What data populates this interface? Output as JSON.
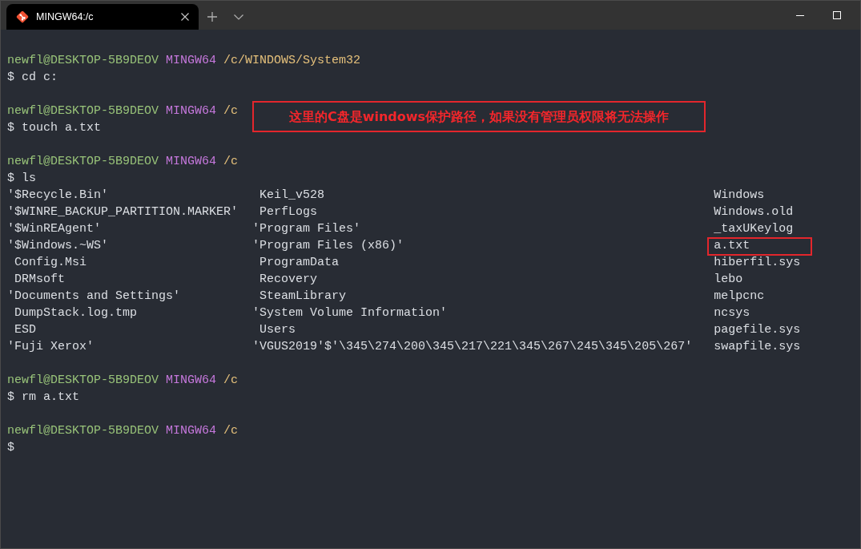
{
  "window": {
    "tab": {
      "title": "MINGW64:/c",
      "selected": true
    }
  },
  "terminal": {
    "blocks": [
      {
        "prompt": {
          "user": "newfl@DESKTOP-5B9DEOV",
          "system": "MINGW64",
          "path": "/c/WINDOWS/System32"
        },
        "command": "$ cd c:"
      },
      {
        "prompt": {
          "user": "newfl@DESKTOP-5B9DEOV",
          "system": "MINGW64",
          "path": "/c"
        },
        "command": "$ touch a.txt"
      },
      {
        "prompt": {
          "user": "newfl@DESKTOP-5B9DEOV",
          "system": "MINGW64",
          "path": "/c"
        },
        "command": "$ ls",
        "listing": {
          "columns": [
            [
              {
                "name": "'$Recycle.Bin'",
                "kind": "quoted",
                "highlighted": false
              },
              {
                "name": "'$WINRE_BACKUP_PARTITION.MARKER'",
                "kind": "quoted",
                "highlighted": false
              },
              {
                "name": "'$WinREAgent'",
                "kind": "quoted",
                "highlighted": false
              },
              {
                "name": "'$Windows.~WS'",
                "kind": "quoted",
                "highlighted": false
              },
              {
                "name": "Config.Msi",
                "kind": "plain",
                "highlighted": false
              },
              {
                "name": "DRMsoft",
                "kind": "plain",
                "highlighted": false
              },
              {
                "name": "'Documents and Settings'",
                "kind": "quoted",
                "highlighted": false
              },
              {
                "name": "DumpStack.log.tmp",
                "kind": "plain",
                "highlighted": false
              },
              {
                "name": "ESD",
                "kind": "plain",
                "highlighted": false
              },
              {
                "name": "'Fuji Xerox'",
                "kind": "quoted",
                "highlighted": false
              }
            ],
            [
              {
                "name": "Keil_v528",
                "kind": "plain",
                "highlighted": false
              },
              {
                "name": "PerfLogs",
                "kind": "plain",
                "highlighted": false
              },
              {
                "name": "'Program Files'",
                "kind": "quoted",
                "highlighted": false
              },
              {
                "name": "'Program Files (x86)'",
                "kind": "quoted",
                "highlighted": false
              },
              {
                "name": "ProgramData",
                "kind": "plain",
                "highlighted": false
              },
              {
                "name": "Recovery",
                "kind": "plain",
                "highlighted": false
              },
              {
                "name": "SteamLibrary",
                "kind": "plain",
                "highlighted": false
              },
              {
                "name": "'System Volume Information'",
                "kind": "quoted",
                "highlighted": false
              },
              {
                "name": "Users",
                "kind": "plain",
                "highlighted": false
              },
              {
                "name": "'VGUS2019'$'\\345\\274\\200\\345\\217\\221\\345\\267\\245\\345\\205\\267'",
                "kind": "quoted",
                "highlighted": false
              }
            ],
            [
              {
                "name": "Windows",
                "kind": "plain",
                "highlighted": false
              },
              {
                "name": "Windows.old",
                "kind": "plain",
                "highlighted": false
              },
              {
                "name": "_taxUKeylog",
                "kind": "plain",
                "highlighted": false
              },
              {
                "name": "a.txt",
                "kind": "plain",
                "highlighted": true
              },
              {
                "name": "hiberfil.sys",
                "kind": "plain",
                "highlighted": false
              },
              {
                "name": "lebo",
                "kind": "plain",
                "highlighted": false
              },
              {
                "name": "melpcnc",
                "kind": "plain",
                "highlighted": false
              },
              {
                "name": "ncsys",
                "kind": "plain",
                "highlighted": false
              },
              {
                "name": "pagefile.sys",
                "kind": "plain",
                "highlighted": false
              },
              {
                "name": "swapfile.sys",
                "kind": "plain",
                "highlighted": false
              }
            ]
          ]
        }
      },
      {
        "prompt": {
          "user": "newfl@DESKTOP-5B9DEOV",
          "system": "MINGW64",
          "path": "/c"
        },
        "command": "$ rm a.txt"
      },
      {
        "prompt": {
          "user": "newfl@DESKTOP-5B9DEOV",
          "system": "MINGW64",
          "path": "/c"
        },
        "command": "$"
      }
    ]
  },
  "annotation": {
    "text": "这里的C盘是windows保护路径，如果没有管理员权限将无法操作"
  }
}
